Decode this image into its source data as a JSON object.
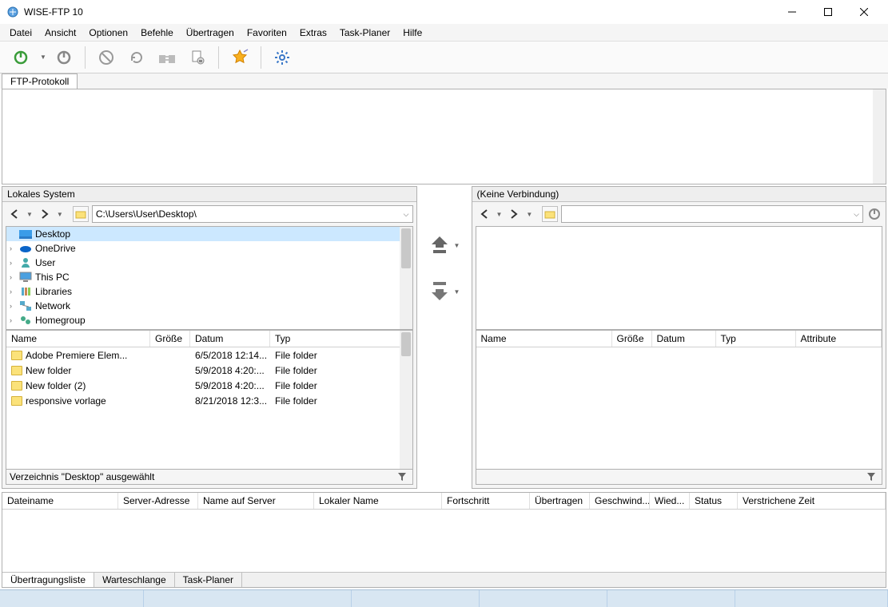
{
  "title": "WISE-FTP 10",
  "menu": [
    "Datei",
    "Ansicht",
    "Optionen",
    "Befehle",
    "Übertragen",
    "Favoriten",
    "Extras",
    "Task-Planer",
    "Hilfe"
  ],
  "protocol_tab": "FTP-Protokoll",
  "local": {
    "title": "Lokales System",
    "path": "C:\\Users\\User\\Desktop\\",
    "tree": [
      {
        "label": "Desktop",
        "icon": "desktop",
        "sel": true,
        "expand": ""
      },
      {
        "label": "OneDrive",
        "icon": "onedrive",
        "expand": "›"
      },
      {
        "label": "User",
        "icon": "user",
        "expand": "›"
      },
      {
        "label": "This PC",
        "icon": "pc",
        "expand": "›"
      },
      {
        "label": "Libraries",
        "icon": "lib",
        "expand": "›"
      },
      {
        "label": "Network",
        "icon": "net",
        "expand": "›"
      },
      {
        "label": "Homegroup",
        "icon": "home",
        "expand": "›"
      }
    ],
    "columns": [
      "Name",
      "Größe",
      "Datum",
      "Typ"
    ],
    "rows": [
      {
        "name": "Adobe Premiere Elem...",
        "size": "",
        "date": "6/5/2018 12:14...",
        "type": "File folder"
      },
      {
        "name": "New folder",
        "size": "",
        "date": "5/9/2018 4:20:...",
        "type": "File folder"
      },
      {
        "name": "New folder (2)",
        "size": "",
        "date": "5/9/2018 4:20:...",
        "type": "File folder"
      },
      {
        "name": "responsive vorlage",
        "size": "",
        "date": "8/21/2018 12:3...",
        "type": "File folder"
      }
    ],
    "status": "Verzeichnis \"Desktop\" ausgewählt"
  },
  "remote": {
    "title": "(Keine Verbindung)",
    "path": "",
    "columns": [
      "Name",
      "Größe",
      "Datum",
      "Typ",
      "Attribute"
    ]
  },
  "transfer_columns": [
    "Dateiname",
    "Server-Adresse",
    "Name auf Server",
    "Lokaler Name",
    "Fortschritt",
    "Übertragen",
    "Geschwind...",
    "Wied...",
    "Status",
    "Verstrichene Zeit"
  ],
  "bottom_tabs": [
    "Übertragungsliste",
    "Warteschlange",
    "Task-Planer"
  ]
}
